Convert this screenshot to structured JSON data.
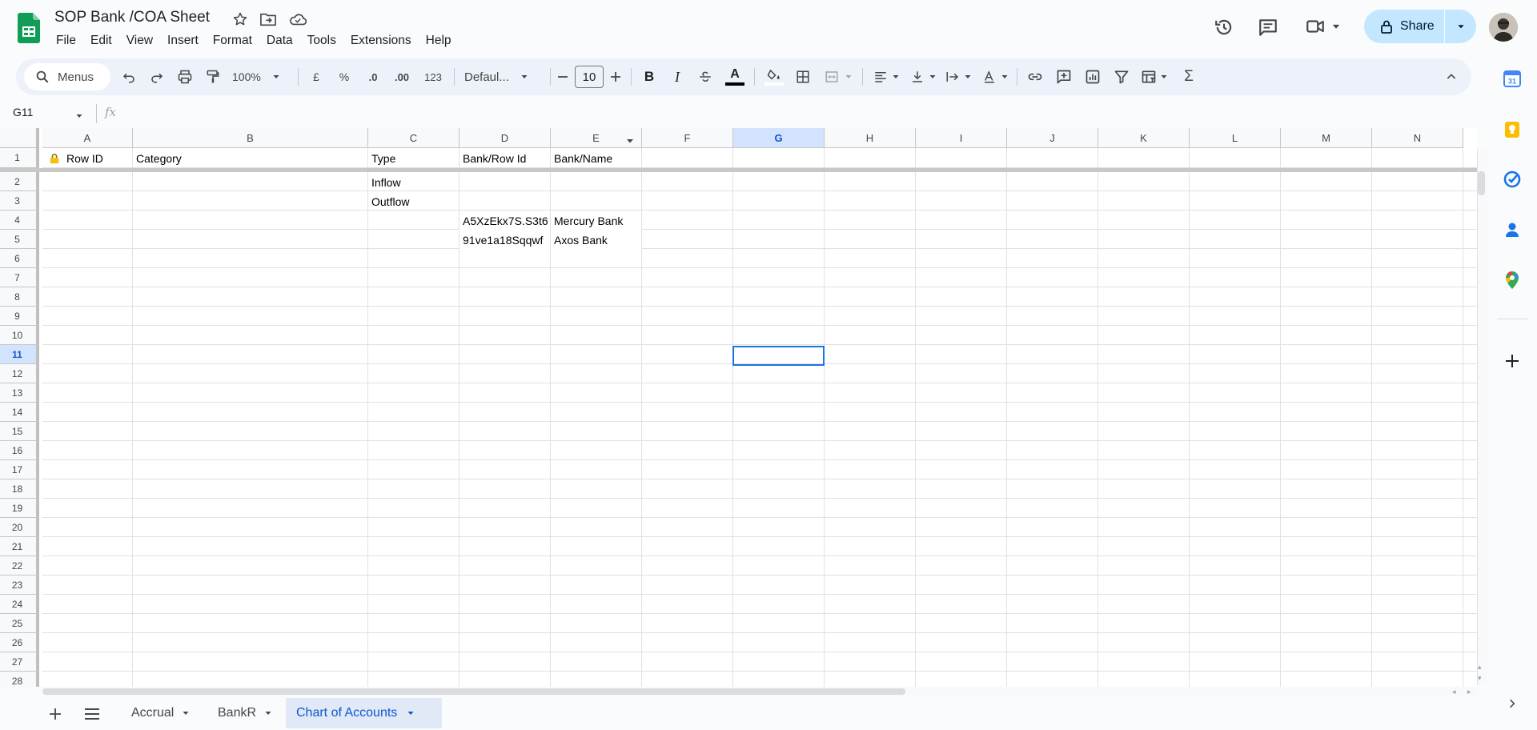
{
  "document": {
    "title": "SOP Bank /COA Sheet"
  },
  "menu": [
    "File",
    "Edit",
    "View",
    "Insert",
    "Format",
    "Data",
    "Tools",
    "Extensions",
    "Help"
  ],
  "share": {
    "label": "Share"
  },
  "toolbar": {
    "search_label": "Menus",
    "zoom": "100%",
    "currency": "£",
    "percent": "%",
    "decrease_decimal": ".0",
    "increase_decimal": ".00",
    "number_format": "123",
    "font": "Defaul...",
    "font_size": "10"
  },
  "formula_bar": {
    "name_box": "G11",
    "fx": "fx",
    "value": ""
  },
  "grid": {
    "columns": [
      "A",
      "B",
      "C",
      "D",
      "E",
      "F",
      "G",
      "H",
      "I",
      "J",
      "K",
      "L",
      "M",
      "N"
    ],
    "selected_column": "G",
    "selected_row": "11",
    "rows": [
      "1",
      "2",
      "3",
      "4",
      "5",
      "6",
      "7",
      "8",
      "9",
      "10",
      "11",
      "12",
      "13",
      "14",
      "15",
      "16",
      "17",
      "18",
      "19",
      "20",
      "21",
      "22",
      "23",
      "24",
      "25",
      "26",
      "27",
      "28"
    ],
    "header_row": {
      "A": "Row ID",
      "B": "Category",
      "C": "Type",
      "D": "Bank/Row Id",
      "E": "Bank/Name"
    },
    "cells": {
      "C2": "Inflow",
      "C3": "Outflow",
      "D4": "A5XzEkx7S.S3t6",
      "E4": "Mercury Bank",
      "D5": "91ve1a18Sqqwf",
      "E5": "Axos Bank"
    }
  },
  "sheets": [
    {
      "name": "Accrual",
      "active": false
    },
    {
      "name": "BankR",
      "active": false
    },
    {
      "name": "Chart of Accounts",
      "active": true
    }
  ],
  "colors": {
    "accent": "#0b57d0",
    "share_bg": "#c2e7ff",
    "toolbar_bg": "#edf2fa",
    "sheets_green": "#0f9d58"
  }
}
